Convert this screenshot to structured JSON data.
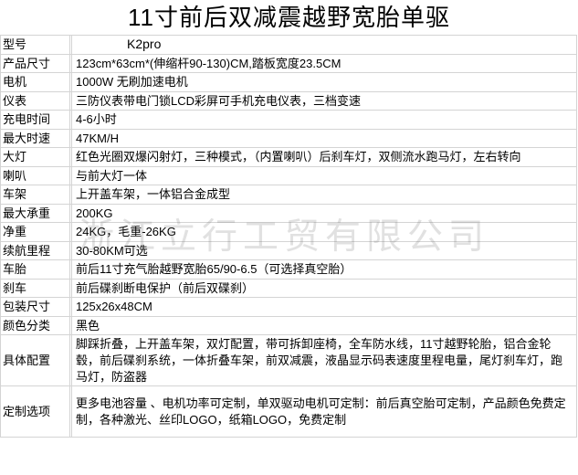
{
  "title": "11寸前后双减震越野宽胎单驱",
  "watermark": "浙江立行工贸有限公司",
  "specs": [
    {
      "label": "型号",
      "value": "K2pro"
    },
    {
      "label": "产品尺寸",
      "value": "123cm*63cm*(伸缩杆90-130)CM,踏板宽度23.5CM"
    },
    {
      "label": "电机",
      "value": "1000W 无刷加速电机"
    },
    {
      "label": "仪表",
      "value": "三防仪表带电门锁LCD彩屏可手机充电仪表，三档变速"
    },
    {
      "label": "充电时间",
      "value": "4-6小时"
    },
    {
      "label": "最大时速",
      "value": "47KM/H"
    },
    {
      "label": "大灯",
      "value": "红色光圈双爆闪射灯，三种模式，（内置喇叭）后刹车灯，双侧流水跑马灯，左右转向"
    },
    {
      "label": "喇叭",
      "value": "与前大灯一体"
    },
    {
      "label": "车架",
      "value": "上开盖车架，一体铝合金成型"
    },
    {
      "label": "最大承重",
      "value": "200KG"
    },
    {
      "label": "净重",
      "value": "24KG，毛重-26KG"
    },
    {
      "label": "续航里程",
      "value": "30-80KM可选"
    },
    {
      "label": "车胎",
      "value": "前后11寸充气胎越野宽胎65/90-6.5（可选择真空胎）"
    },
    {
      "label": "刹车",
      "value": "前后碟刹断电保护（前后双碟刹）"
    },
    {
      "label": "包装尺寸",
      "value": "125x26x48CM"
    },
    {
      "label": "颜色分类",
      "value": "黑色"
    },
    {
      "label": "具体配置",
      "value": "脚踩折叠，上开盖车架，双灯配置，带可拆卸座椅，全车防水线，11寸越野轮胎，铝合金轮毂，前后碟刹系统，一体折叠车架，前双减震，液晶显示码表速度里程电量，尾灯刹车灯，跑马灯，防盗器"
    },
    {
      "label": "定制选项",
      "value": "更多电池容量 、电机功率可定制，单双驱动电机可定制：前后真空胎可定制，产品颜色免费定制，各种激光、丝印LOGO，纸箱LOGO，免费定制"
    }
  ]
}
